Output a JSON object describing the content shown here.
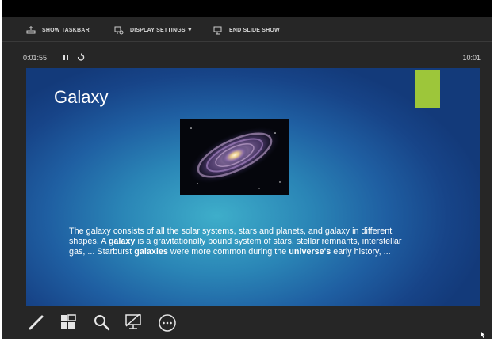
{
  "toolbar": {
    "show_taskbar": "SHOW TASKBAR",
    "display_settings": "DISPLAY SETTINGS ▼",
    "end_slide_show": "END SLIDE SHOW"
  },
  "timer": {
    "elapsed": "0:01:55",
    "clock": "10:01"
  },
  "slide": {
    "title": "Galaxy",
    "accent_color": "#9dc63a",
    "body_parts": [
      "The galaxy consists of all the solar systems, stars and planets, and galaxy in different shapes. A ",
      "galaxy",
      " is a gravitationally bound system of stars, stellar remnants, interstellar gas, ... Starburst ",
      "galaxies",
      " were more common during the ",
      "universe's",
      " early history, ..."
    ]
  },
  "icons": {
    "pen": "pen-icon",
    "slides": "see-all-slides-icon",
    "zoom": "zoom-icon",
    "screen": "black-screen-icon",
    "more": "more-options-icon"
  }
}
